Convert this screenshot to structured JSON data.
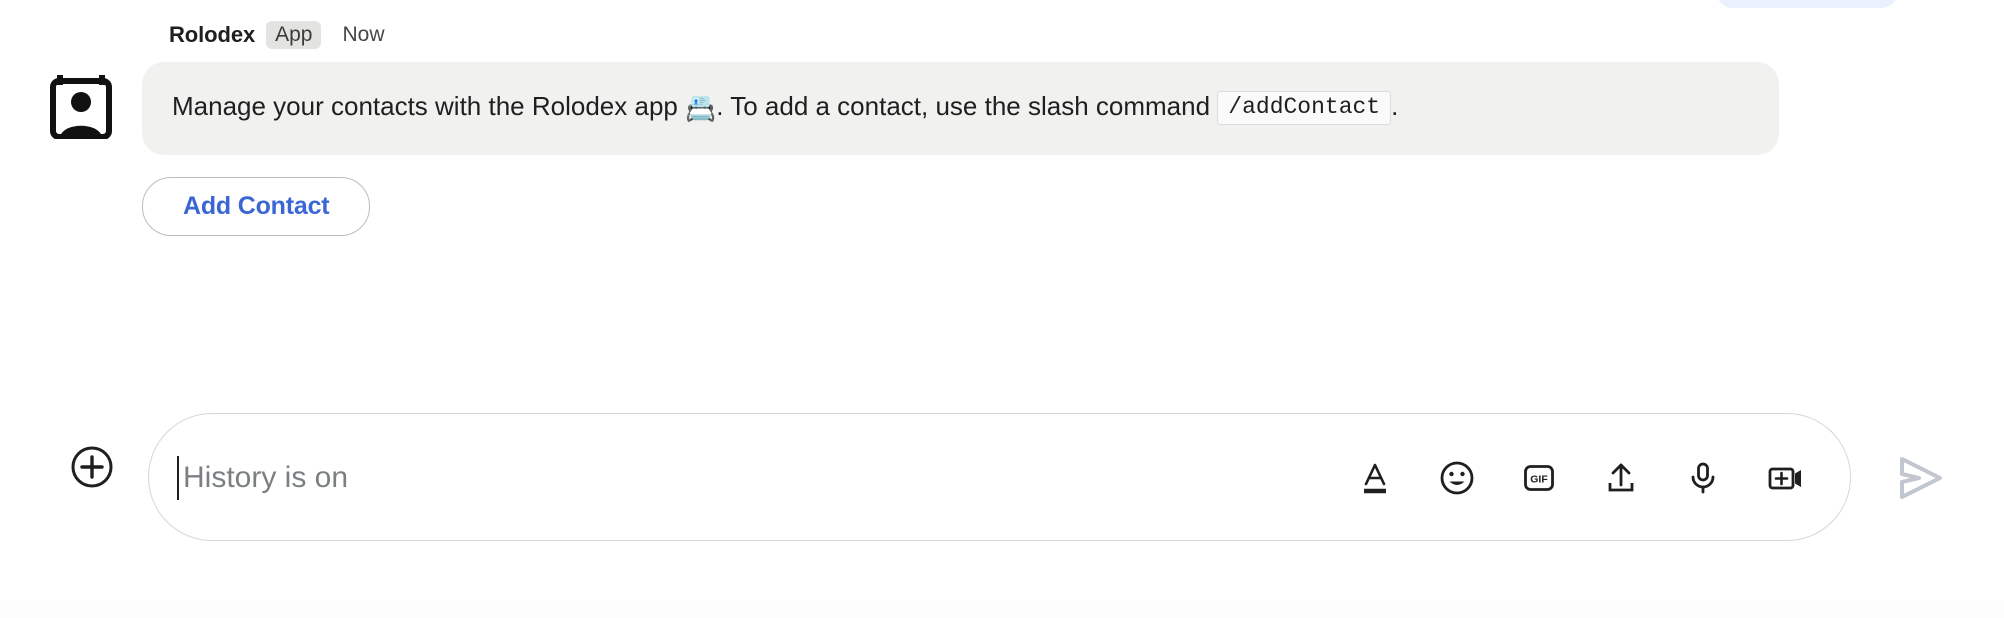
{
  "message": {
    "sender": "Rolodex",
    "badge": "App",
    "time": "Now",
    "avatar_icon": "contact-card-icon",
    "body_part1": "Manage your contacts with the Rolodex app ",
    "emoji": "📇",
    "body_part2": ". To add a contact, use the slash command ",
    "code": "/addContact",
    "body_part3": ".",
    "action_button": "Add Contact",
    "bubble_color": "#f1f1f0",
    "action_text_color": "#3b67d4"
  },
  "composer": {
    "add_icon": "plus-circle-icon",
    "placeholder": "History is on",
    "value": "",
    "tools": [
      {
        "icon": "format-text-icon",
        "label": "Format text"
      },
      {
        "icon": "emoji-icon",
        "label": "Insert emoji"
      },
      {
        "icon": "gif-icon",
        "label": "GIF"
      },
      {
        "icon": "upload-icon",
        "label": "Upload file"
      },
      {
        "icon": "microphone-icon",
        "label": "Record voice message"
      },
      {
        "icon": "video-add-icon",
        "label": "Record video message"
      }
    ],
    "gif_label": "GIF",
    "send_icon": "send-icon",
    "send_label": "Send"
  }
}
